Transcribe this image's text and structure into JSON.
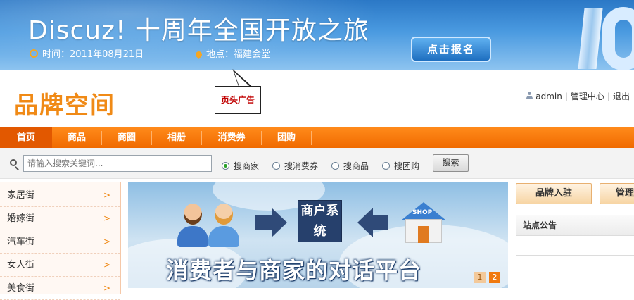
{
  "banner": {
    "title": "Discuz! 十周年全国开放之旅",
    "time": "时间：2011年08月21日",
    "place": "地点：福建会堂",
    "signup": "点击报名"
  },
  "header": {
    "logo": "品牌空间",
    "ad": "页头广告",
    "user": "admin",
    "admin_center": "管理中心",
    "logout": "退出"
  },
  "nav": [
    "首页",
    "商品",
    "商圈",
    "相册",
    "消费券",
    "团购"
  ],
  "search": {
    "placeholder": "请输入搜索关键词...",
    "options": [
      "搜商家",
      "搜消费券",
      "搜商品",
      "搜团购"
    ],
    "selected": "搜商家",
    "button": "搜索"
  },
  "categories": [
    "家居街",
    "婚嫁街",
    "汽车街",
    "女人街",
    "美食街"
  ],
  "category_arrow": ">",
  "slide": {
    "box": "商户系统",
    "shop": "SHOP",
    "slogan": "消费者与商家的对话平台",
    "pages": [
      "1",
      "2"
    ],
    "current_page": "2"
  },
  "sidebar": {
    "join": "品牌入驻",
    "manage": "管理",
    "notice_title": "站点公告"
  },
  "colors": {
    "nav_orange": "#f06a00",
    "brand_orange": "#f08a16",
    "banner_blue": "#2b78c6",
    "ad_red": "#c00000"
  }
}
